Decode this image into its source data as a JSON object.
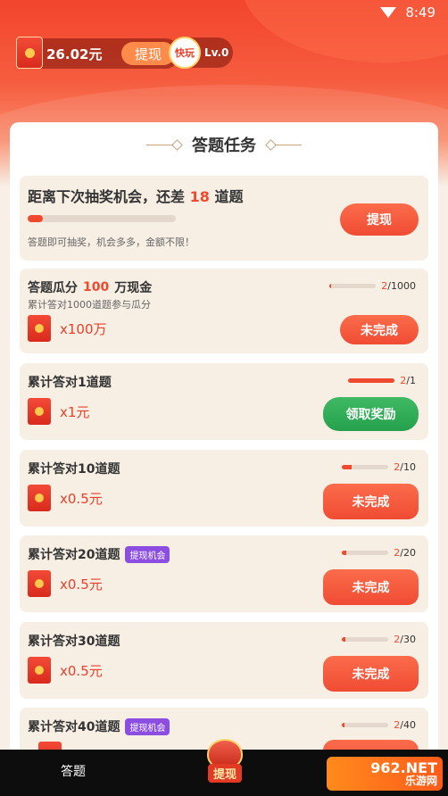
{
  "status": {
    "time": "8:49"
  },
  "header": {
    "balance": "26.02元",
    "withdraw_label": "提现",
    "level_logo": "快玩",
    "level": "Lv.0"
  },
  "panel": {
    "title": "答题任务"
  },
  "lottery": {
    "prefix": "距离下次抽奖机会，还差",
    "remaining": "18",
    "suffix": "道题",
    "progress": 0.1,
    "sub": "答题即可抽奖，机会多多，金额不限！",
    "button": "提现"
  },
  "tasks": [
    {
      "title_pre": "答题瓜分",
      "title_hl": "100",
      "title_post": "万现金",
      "sub": "累计答对1000道题参与瓜分",
      "done": "2",
      "total": "/1000",
      "progress": 0.002,
      "reward": "x100万",
      "button": "未完成",
      "badge": ""
    },
    {
      "title_pre": "累计答对1道题",
      "title_hl": "",
      "title_post": "",
      "done": "2",
      "total": "/1",
      "progress": 1.0,
      "reward": "x1元",
      "button": "领取奖励",
      "badge": ""
    },
    {
      "title_pre": "累计答对10道题",
      "title_hl": "",
      "title_post": "",
      "done": "2",
      "total": "/10",
      "progress": 0.2,
      "reward": "x0.5元",
      "button": "未完成",
      "badge": ""
    },
    {
      "title_pre": "累计答对20道题",
      "title_hl": "",
      "title_post": "",
      "done": "2",
      "total": "/20",
      "progress": 0.1,
      "reward": "x0.5元",
      "button": "未完成",
      "badge": "提现机会"
    },
    {
      "title_pre": "累计答对30道题",
      "title_hl": "",
      "title_post": "",
      "done": "2",
      "total": "/30",
      "progress": 0.067,
      "reward": "x0.5元",
      "button": "未完成",
      "badge": ""
    },
    {
      "title_pre": "累计答对40道题",
      "title_hl": "",
      "title_post": "",
      "done": "2",
      "total": "/40",
      "progress": 0.05,
      "reward": "",
      "button": "",
      "badge": "提现机会"
    }
  ],
  "nav": {
    "quiz": "答题",
    "withdraw": "提现",
    "watermark_big": "962.NET",
    "watermark_small": "乐游网"
  },
  "colors": {
    "accent": "#f0492e",
    "green": "#25a04c",
    "card_bg": "#f7eee4"
  }
}
